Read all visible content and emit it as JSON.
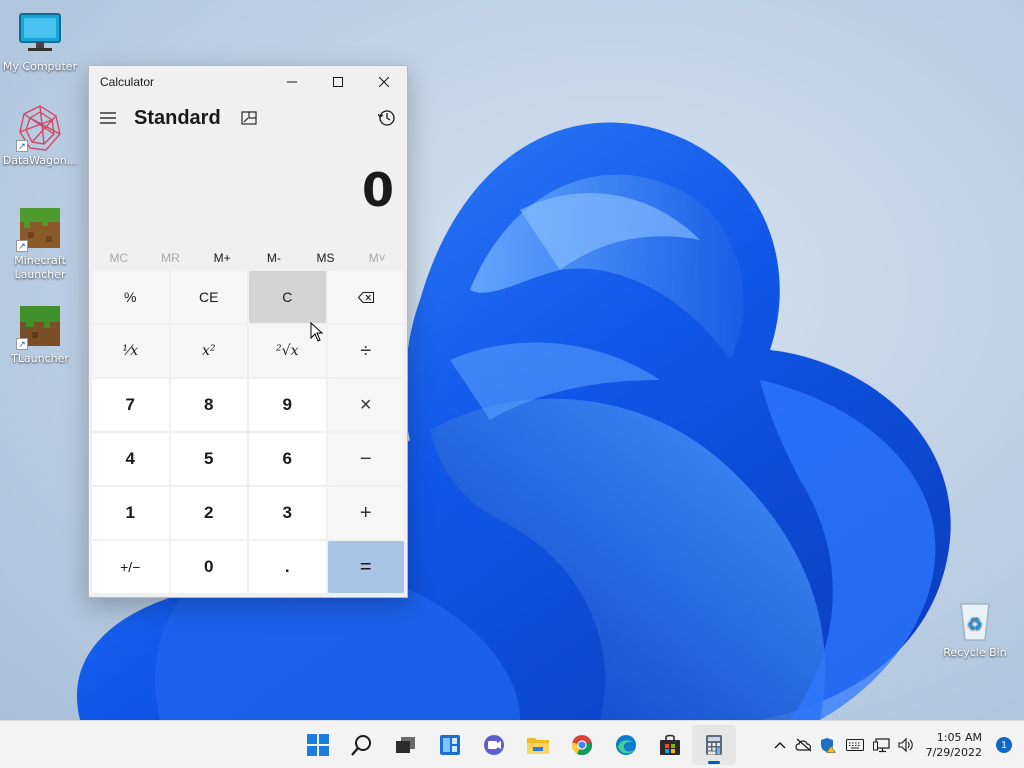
{
  "desktop": {
    "icons": [
      {
        "label": "My Computer",
        "icon": "monitor-icon"
      },
      {
        "label": "DataWagon...",
        "icon": "datawagon-icon"
      },
      {
        "label": "Minecraft Launcher",
        "icon": "minecraft-icon"
      },
      {
        "label": "TLauncher",
        "icon": "tlauncher-icon"
      },
      {
        "label": "Recycle Bin",
        "icon": "recycle-bin-icon"
      }
    ]
  },
  "calculator": {
    "window_title": "Calculator",
    "mode": "Standard",
    "display_value": "0",
    "memory": [
      "MC",
      "MR",
      "M+",
      "M-",
      "MS",
      "M˅"
    ],
    "keys": [
      {
        "label": "%",
        "kind": "fn"
      },
      {
        "label": "CE",
        "kind": "fn"
      },
      {
        "label": "C",
        "kind": "fn"
      },
      {
        "label": "backspace",
        "kind": "fn"
      },
      {
        "label": "¹⁄x",
        "kind": "fn"
      },
      {
        "label": "x²",
        "kind": "fn"
      },
      {
        "label": "²√x",
        "kind": "fn"
      },
      {
        "label": "÷",
        "kind": "op"
      },
      {
        "label": "7",
        "kind": "num"
      },
      {
        "label": "8",
        "kind": "num"
      },
      {
        "label": "9",
        "kind": "num"
      },
      {
        "label": "×",
        "kind": "op"
      },
      {
        "label": "4",
        "kind": "num"
      },
      {
        "label": "5",
        "kind": "num"
      },
      {
        "label": "6",
        "kind": "num"
      },
      {
        "label": "−",
        "kind": "op"
      },
      {
        "label": "1",
        "kind": "num"
      },
      {
        "label": "2",
        "kind": "num"
      },
      {
        "label": "3",
        "kind": "num"
      },
      {
        "label": "+",
        "kind": "op"
      },
      {
        "label": "+/−",
        "kind": "num"
      },
      {
        "label": "0",
        "kind": "num"
      },
      {
        "label": ".",
        "kind": "num"
      },
      {
        "label": "=",
        "kind": "equals"
      }
    ]
  },
  "taskbar": {
    "apps": [
      "start-icon",
      "search-icon",
      "task-view-icon",
      "widgets-icon",
      "chat-icon",
      "file-explorer-icon",
      "chrome-icon",
      "edge-icon",
      "store-icon",
      "calculator-icon"
    ],
    "time": "1:05 AM",
    "date": "7/29/2022",
    "notification_count": "1"
  },
  "colors": {
    "accent": "#005fb8",
    "equals_key": "#a7c4e4",
    "wallpaper_blue": "#1f5fe0"
  }
}
